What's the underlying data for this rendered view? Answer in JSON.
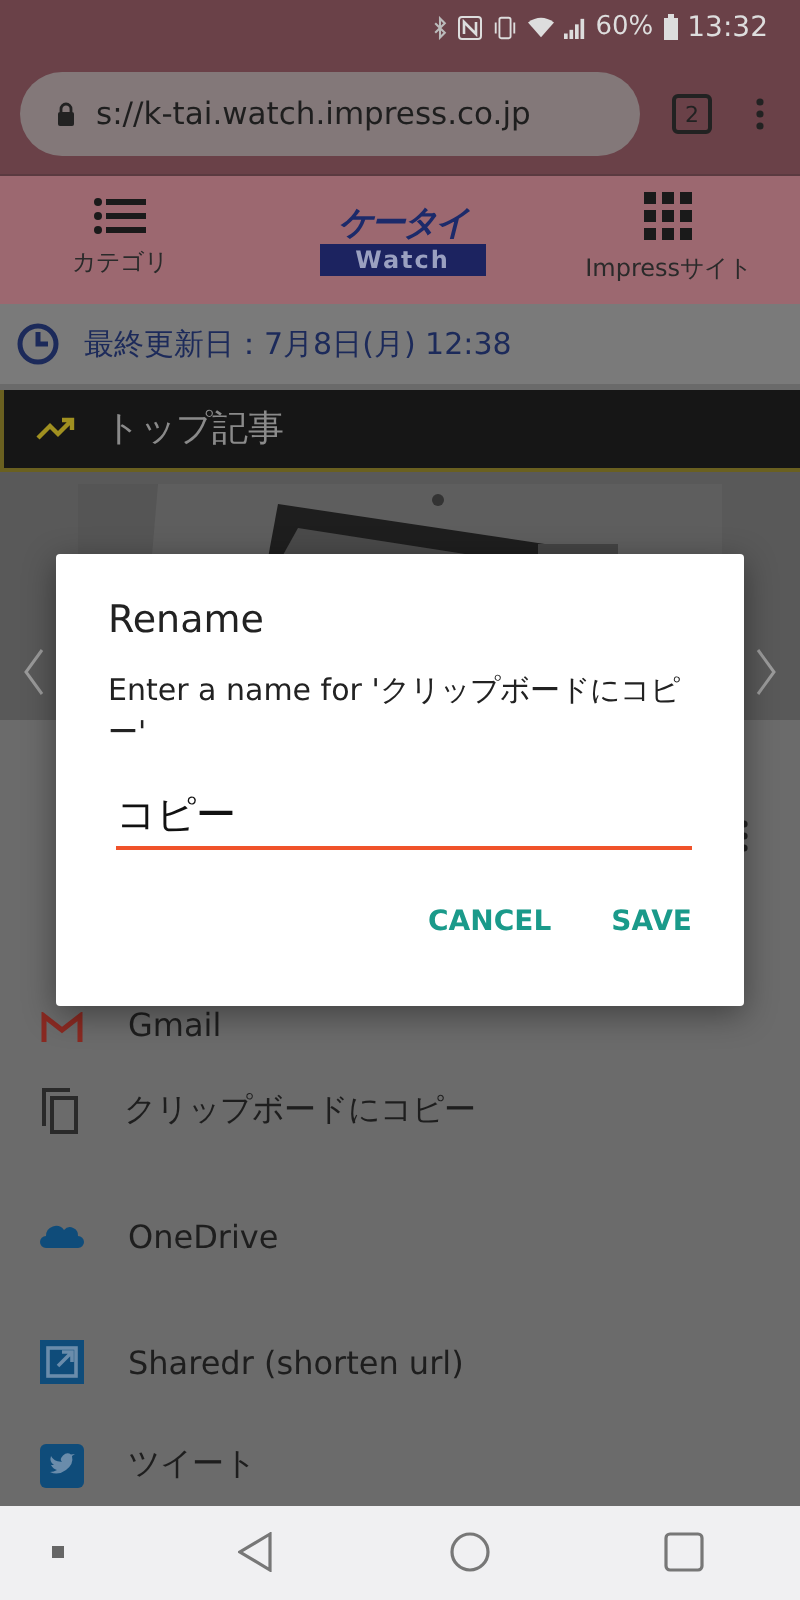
{
  "status_bar": {
    "battery": "60%",
    "time": "13:32"
  },
  "browser": {
    "url": "s://k-tai.watch.impress.co.jp",
    "tab_count": "2"
  },
  "site_nav": {
    "left": "カテゴリ",
    "logo_top": "ケータイ",
    "logo_bottom": "Watch",
    "right": "Impressサイト"
  },
  "updated": "最終更新日：7月8日(月) 12:38",
  "section_title": "トップ記事",
  "share_items": [
    {
      "kind": "gmail",
      "label": "Gmail"
    },
    {
      "kind": "copy",
      "label": "クリップボードにコピー"
    },
    {
      "kind": "onedrive",
      "label": "OneDrive"
    },
    {
      "kind": "sharedr",
      "label": "Sharedr (shorten url)"
    },
    {
      "kind": "twitter",
      "label": "ツイート"
    }
  ],
  "dialog": {
    "title": "Rename",
    "message": "Enter a name for 'クリップボードにコピー'",
    "value": "コピー",
    "buttons": [
      "CANCEL",
      "SAVE"
    ]
  }
}
